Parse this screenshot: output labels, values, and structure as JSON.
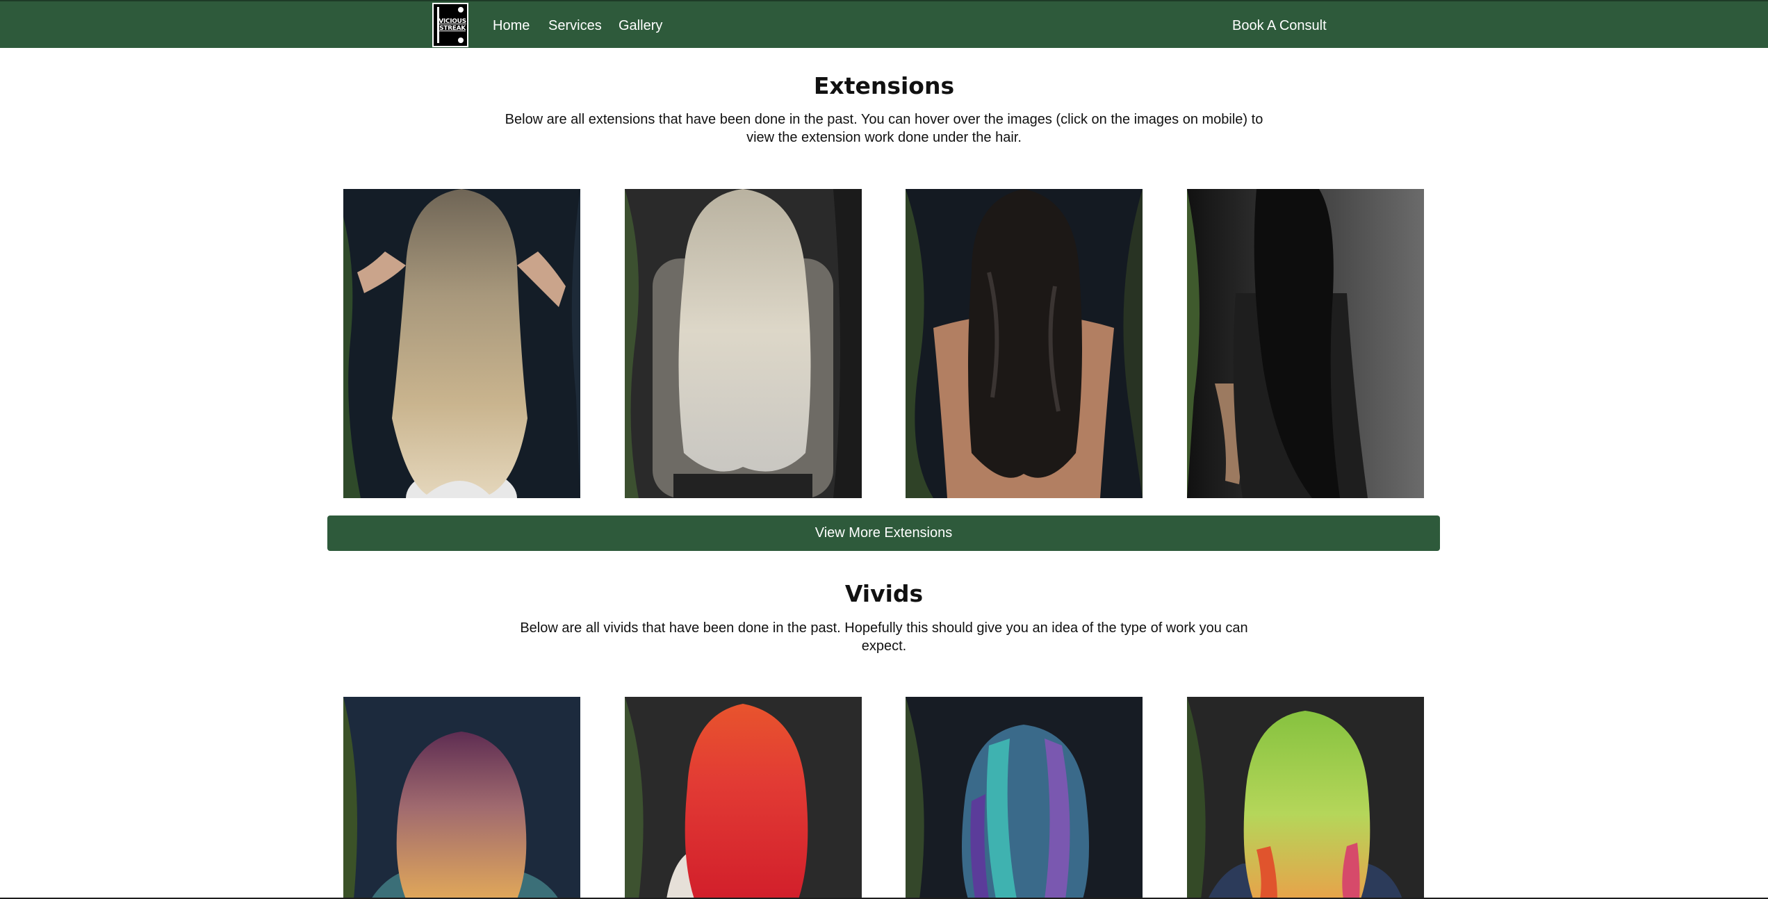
{
  "nav": {
    "logo_text": [
      "VICIOUS",
      "STREAK"
    ],
    "links": [
      "Home",
      "Services",
      "Gallery"
    ],
    "cta": "Book A Consult",
    "bg_color": "#2e5a3b"
  },
  "extensions": {
    "title": "Extensions",
    "description": "Below are all extensions that have been done in the past. You can hover over the images (click on the images on mobile) to view the extension work done under the hair.",
    "photos": [
      "blonde-balayage-long-waves",
      "platinum-blonde-waves",
      "dark-brunette-waves",
      "sleek-black-straight"
    ],
    "button": "View More Extensions"
  },
  "vivids": {
    "title": "Vivids",
    "description": "Below are all vivids that have been done in the past. Hopefully this should give you an idea of the type of work you can expect.",
    "photos": [
      "purple-to-orange-waves",
      "red-orange-waves",
      "blue-teal-purple-waves",
      "lime-green-rainbow-waves"
    ]
  }
}
